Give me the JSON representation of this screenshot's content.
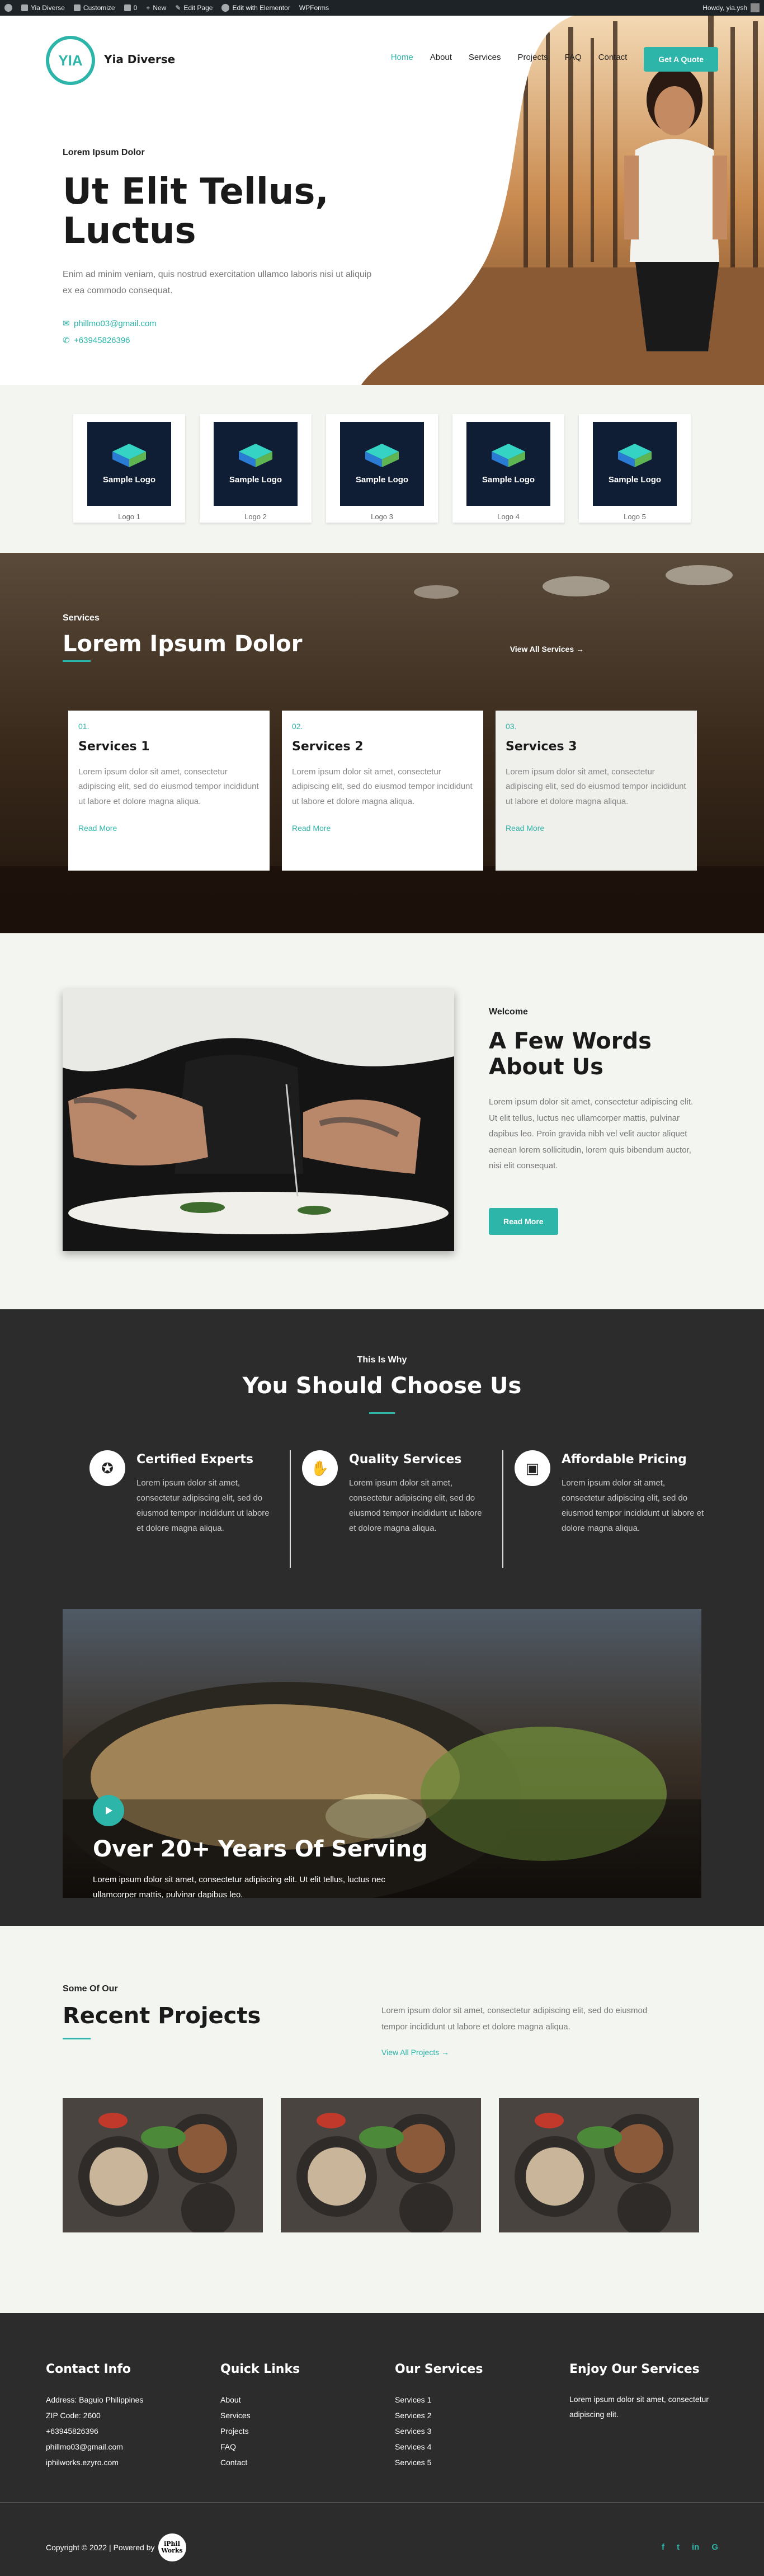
{
  "adminbar": {
    "site": "Yia Diverse",
    "customize": "Customize",
    "comments": "0",
    "new": "New",
    "edit_page": "Edit Page",
    "elementor": "Edit with Elementor",
    "wpforms": "WPForms",
    "howdy": "Howdy, yia.ysh"
  },
  "header": {
    "logo_text": "YIA",
    "site_title": "Yia Diverse",
    "nav": [
      "Home",
      "About",
      "Services",
      "Projects",
      "FAQ",
      "Contact"
    ],
    "cta": "Get A Quote"
  },
  "hero": {
    "kicker": "Lorem Ipsum Dolor",
    "title": "Ut Elit Tellus, Luctus",
    "description": "Enim ad minim veniam, quis nostrud exercitation ullamco laboris nisi ut aliquip ex ea commodo consequat.",
    "email": "phillmo03@gmail.com",
    "phone": "+63945826396"
  },
  "logos": [
    {
      "img_text": "Sample Logo",
      "caption": "Logo 1"
    },
    {
      "img_text": "Sample Logo",
      "caption": "Logo 2"
    },
    {
      "img_text": "Sample Logo",
      "caption": "Logo 3"
    },
    {
      "img_text": "Sample Logo",
      "caption": "Logo 4"
    },
    {
      "img_text": "Sample Logo",
      "caption": "Logo 5"
    }
  ],
  "services": {
    "kicker": "Services",
    "title": "Lorem Ipsum Dolor",
    "view_all": "View All Services",
    "cards": [
      {
        "num": "01.",
        "name": "Services 1",
        "desc": "Lorem ipsum dolor sit amet, consectetur adipiscing elit, sed do eiusmod tempor incididunt ut labore et dolore magna aliqua.",
        "more": "Read More"
      },
      {
        "num": "02.",
        "name": "Services 2",
        "desc": "Lorem ipsum dolor sit amet, consectetur adipiscing elit, sed do eiusmod tempor incididunt ut labore et dolore magna aliqua.",
        "more": "Read More"
      },
      {
        "num": "03.",
        "name": "Services 3",
        "desc": "Lorem ipsum dolor sit amet, consectetur adipiscing elit, sed do eiusmod tempor incididunt ut labore et dolore magna aliqua.",
        "more": "Read More"
      }
    ]
  },
  "about": {
    "kicker": "Welcome",
    "title": "A Few Words About Us",
    "desc": "Lorem ipsum dolor sit amet, consectetur adipiscing elit. Ut elit tellus, luctus nec ullamcorper mattis, pulvinar dapibus leo. Proin gravida nibh vel velit auctor aliquet aenean lorem sollicitudin, lorem quis bibendum auctor, nisi elit consequat.",
    "button": "Read More"
  },
  "why": {
    "kicker": "This Is Why",
    "title": "You Should Choose Us",
    "features": [
      {
        "title": "Certified Experts",
        "desc": "Lorem ipsum dolor sit amet, consectetur adipiscing elit, sed do eiusmod tempor incididunt ut labore et dolore magna aliqua.",
        "icon": "award-icon"
      },
      {
        "title": "Quality Services",
        "desc": "Lorem ipsum dolor sit amet, consectetur adipiscing elit, sed do eiusmod tempor incididunt ut labore et dolore magna aliqua.",
        "icon": "handshake-icon"
      },
      {
        "title": "Affordable Pricing",
        "desc": "Lorem ipsum dolor sit amet, consectetur adipiscing elit, sed do eiusmod tempor incididunt ut labore et dolore magna aliqua.",
        "icon": "wallet-icon"
      }
    ],
    "banner_title": "Over 20+ Years Of Serving",
    "banner_desc": "Lorem ipsum dolor sit amet, consectetur adipiscing elit. Ut elit tellus, luctus nec ullamcorper mattis, pulvinar dapibus leo."
  },
  "projects": {
    "kicker": "Some Of Our",
    "title": "Recent Projects",
    "desc": "Lorem ipsum dolor sit amet, consectetur adipiscing elit, sed do eiusmod tempor incididunt ut labore et dolore magna aliqua.",
    "view_all": "View All Projects"
  },
  "footer": {
    "contact_title": "Contact Info",
    "contact_lines": [
      "Address: Baguio Philippines",
      "ZIP Code: 2600",
      "+63945826396",
      "phillmo03@gmail.com",
      "iphilworks.ezyro.com"
    ],
    "links_title": "Quick Links",
    "links": [
      "About",
      "Services",
      "Projects",
      "FAQ",
      "Contact"
    ],
    "services_title": "Our Services",
    "services": [
      "Services 1",
      "Services 2",
      "Services 3",
      "Services 4",
      "Services 5"
    ],
    "enjoy_title": "Enjoy Our Services",
    "enjoy_desc": "Lorem ipsum dolor sit amet, consectetur adipiscing elit.",
    "copyright": "Copyright © 2022 | Powered by",
    "powered_logo": "iPhil Works",
    "social": [
      "f",
      "t",
      "in",
      "G"
    ]
  },
  "colors": {
    "accent": "#2cb5a8",
    "dark": "#2c2c2c",
    "light_bg": "#f3f5f1"
  }
}
